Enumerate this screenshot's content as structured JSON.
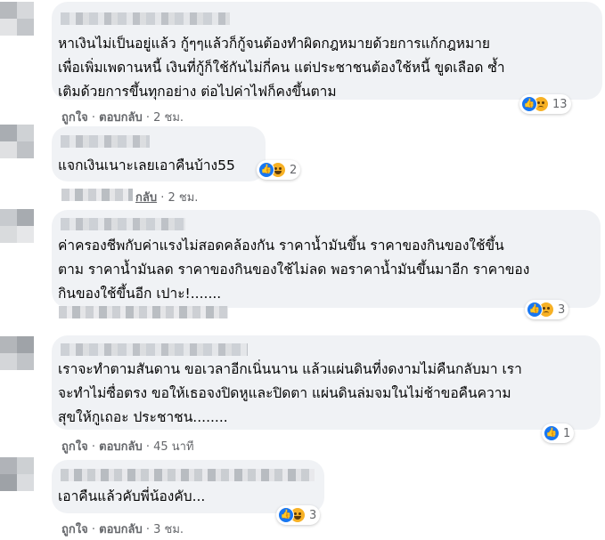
{
  "comments": [
    {
      "lines": [
        "หาเงินไม่เป็นอยู่แล้ว กู้ๆๆแล้วก็กู้จนต้องทำผิดกฎหมายด้วยการแก้กฎหมาย",
        "เพื่อเพิ่มเพดานหนี้ เงินที่กู้ก็ใช้กันไม่กี่คน แต่ประชาชนต้องใช้หนี้ ขูดเลือด ซ้ำ",
        "เติมด้วยการขึ้นทุกอย่าง ต่อไปค่าไฟก็คงขึ้นตาม"
      ],
      "like_label": "ถูกใจ",
      "reply_label": "ตอบกลับ",
      "time": "2 ชม.",
      "reactions": [
        "like-icon",
        "sad-icon"
      ],
      "reaction_count": "13"
    },
    {
      "lines": [
        "แจกเงินเนาะเลยเอาคืนบ้าง55"
      ],
      "like_label": "",
      "reply_label": "กลับ",
      "time": "2 ชม.",
      "reactions": [
        "like-icon",
        "haha-icon"
      ],
      "reaction_count": "2"
    },
    {
      "lines": [
        "ค่าครองชีพกับค่าแรงไม่สอดคล้องกัน ราคาน้ำมันขึ้น ราคาของกินของใช้ขึ้น",
        "ตาม ราคาน้ำมันลด ราคาของกินของใช้ไม่ลด พอราคาน้ำมันขึ้นมาอีก ราคาของ",
        "กินของใช้ขึ้นอีก เปาะ!......."
      ],
      "like_label": "",
      "reply_label": "",
      "time": "",
      "reactions": [
        "like-icon",
        "sad-icon"
      ],
      "reaction_count": "3"
    },
    {
      "lines": [
        "เราจะทำตามสันดาน ขอเวลาอีกเนิ่นนาน แล้วแผ่นดินที่งดงามไม่คืนกลับมา เรา",
        "จะทำไม่ซื่อตรง ขอให้เธอจงปิดหูและปิดตา แผ่นดินล่มจมในไม่ช้าขอคืนความ",
        "สุขให้กูเถอะ ประชาชน........"
      ],
      "like_label": "ถูกใจ",
      "reply_label": "ตอบกลับ",
      "time": "45 นาที",
      "reactions": [
        "like-icon"
      ],
      "reaction_count": "1"
    },
    {
      "lines": [
        "เอาคืนแล้วคับพี่น้องคับ..."
      ],
      "like_label": "ถูกใจ",
      "reply_label": "ตอบกลับ",
      "time": "3 ชม.",
      "reactions": [
        "like-icon",
        "haha-icon"
      ],
      "reaction_count": "3"
    }
  ],
  "separator": "·",
  "colors": {
    "bubble": "#f0f2f5",
    "meta": "#65676b",
    "like": "#1877f2",
    "emoji": "#f7b125"
  }
}
